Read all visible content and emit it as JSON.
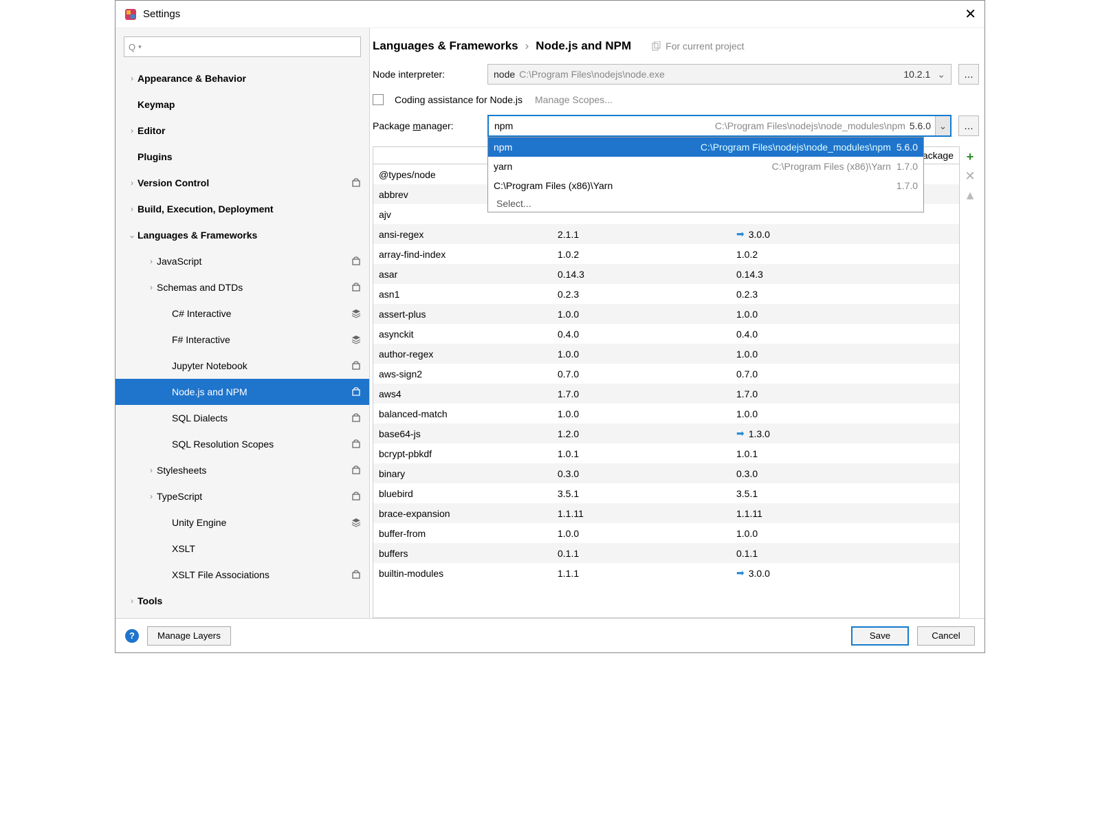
{
  "window": {
    "title": "Settings"
  },
  "breadcrumb": {
    "a": "Languages & Frameworks",
    "b": "Node.js and NPM"
  },
  "scope": "For current project",
  "labels": {
    "node_interpreter": "Node interpreter:",
    "coding_assist": "Coding assistance for Node.js",
    "manage_scopes": "Manage Scopes...",
    "package_manager_pre": "Package ",
    "package_manager_u": "m",
    "package_manager_post": "anager:",
    "col_package": "Package"
  },
  "interpreter": {
    "name": "node",
    "path": "C:\\Program Files\\nodejs\\node.exe",
    "version": "10.2.1"
  },
  "pkgmgr_input": {
    "name": "npm",
    "path": "C:\\Program Files\\nodejs\\node_modules\\npm",
    "version": "5.6.0"
  },
  "dropdown": [
    {
      "name": "npm",
      "path": "C:\\Program Files\\nodejs\\node_modules\\npm",
      "ver": "5.6.0",
      "sel": true
    },
    {
      "name": "yarn",
      "path": "C:\\Program Files (x86)\\Yarn",
      "ver": "1.7.0",
      "sel": false
    },
    {
      "name": "C:\\Program Files (x86)\\Yarn",
      "path": "",
      "ver": "1.7.0",
      "sel": false
    }
  ],
  "dd_select": "Select...",
  "tree": [
    {
      "lbl": "Appearance & Behavior",
      "lvl": 0,
      "bold": true,
      "exp": "›",
      "badge": ""
    },
    {
      "lbl": "Keymap",
      "lvl": 0,
      "bold": true,
      "exp": "",
      "badge": ""
    },
    {
      "lbl": "Editor",
      "lvl": 0,
      "bold": true,
      "exp": "›",
      "badge": ""
    },
    {
      "lbl": "Plugins",
      "lvl": 0,
      "bold": true,
      "exp": "",
      "badge": ""
    },
    {
      "lbl": "Version Control",
      "lvl": 0,
      "bold": true,
      "exp": "›",
      "badge": "bag"
    },
    {
      "lbl": "Build, Execution, Deployment",
      "lvl": 0,
      "bold": true,
      "exp": "›",
      "badge": ""
    },
    {
      "lbl": "Languages & Frameworks",
      "lvl": 0,
      "bold": true,
      "exp": "⌄",
      "badge": ""
    },
    {
      "lbl": "JavaScript",
      "lvl": 1,
      "bold": false,
      "exp": "›",
      "badge": "bag"
    },
    {
      "lbl": "Schemas and DTDs",
      "lvl": 1,
      "bold": false,
      "exp": "›",
      "badge": "bag"
    },
    {
      "lbl": "C# Interactive",
      "lvl": 2,
      "bold": false,
      "exp": "",
      "badge": "layers"
    },
    {
      "lbl": "F# Interactive",
      "lvl": 2,
      "bold": false,
      "exp": "",
      "badge": "layers"
    },
    {
      "lbl": "Jupyter Notebook",
      "lvl": 2,
      "bold": false,
      "exp": "",
      "badge": "bag"
    },
    {
      "lbl": "Node.js and NPM",
      "lvl": 2,
      "bold": false,
      "exp": "",
      "badge": "bag",
      "sel": true
    },
    {
      "lbl": "SQL Dialects",
      "lvl": 2,
      "bold": false,
      "exp": "",
      "badge": "bag"
    },
    {
      "lbl": "SQL Resolution Scopes",
      "lvl": 2,
      "bold": false,
      "exp": "",
      "badge": "bag"
    },
    {
      "lbl": "Stylesheets",
      "lvl": 1,
      "bold": false,
      "exp": "›",
      "badge": "bag"
    },
    {
      "lbl": "TypeScript",
      "lvl": 1,
      "bold": false,
      "exp": "›",
      "badge": "bag"
    },
    {
      "lbl": "Unity Engine",
      "lvl": 2,
      "bold": false,
      "exp": "",
      "badge": "layers"
    },
    {
      "lbl": "XSLT",
      "lvl": 2,
      "bold": false,
      "exp": "",
      "badge": ""
    },
    {
      "lbl": "XSLT File Associations",
      "lvl": 2,
      "bold": false,
      "exp": "",
      "badge": "bag"
    },
    {
      "lbl": "Tools",
      "lvl": 0,
      "bold": true,
      "exp": "›",
      "badge": ""
    }
  ],
  "packages": [
    {
      "name": "@types/node",
      "ver": "",
      "latest": "",
      "upg": false
    },
    {
      "name": "abbrev",
      "ver": "",
      "latest": "",
      "upg": false
    },
    {
      "name": "ajv",
      "ver": "",
      "latest": "",
      "upg": false
    },
    {
      "name": "ansi-regex",
      "ver": "2.1.1",
      "latest": "3.0.0",
      "upg": true
    },
    {
      "name": "array-find-index",
      "ver": "1.0.2",
      "latest": "1.0.2",
      "upg": false
    },
    {
      "name": "asar",
      "ver": "0.14.3",
      "latest": "0.14.3",
      "upg": false
    },
    {
      "name": "asn1",
      "ver": "0.2.3",
      "latest": "0.2.3",
      "upg": false
    },
    {
      "name": "assert-plus",
      "ver": "1.0.0",
      "latest": "1.0.0",
      "upg": false
    },
    {
      "name": "asynckit",
      "ver": "0.4.0",
      "latest": "0.4.0",
      "upg": false
    },
    {
      "name": "author-regex",
      "ver": "1.0.0",
      "latest": "1.0.0",
      "upg": false
    },
    {
      "name": "aws-sign2",
      "ver": "0.7.0",
      "latest": "0.7.0",
      "upg": false
    },
    {
      "name": "aws4",
      "ver": "1.7.0",
      "latest": "1.7.0",
      "upg": false
    },
    {
      "name": "balanced-match",
      "ver": "1.0.0",
      "latest": "1.0.0",
      "upg": false
    },
    {
      "name": "base64-js",
      "ver": "1.2.0",
      "latest": "1.3.0",
      "upg": true
    },
    {
      "name": "bcrypt-pbkdf",
      "ver": "1.0.1",
      "latest": "1.0.1",
      "upg": false
    },
    {
      "name": "binary",
      "ver": "0.3.0",
      "latest": "0.3.0",
      "upg": false
    },
    {
      "name": "bluebird",
      "ver": "3.5.1",
      "latest": "3.5.1",
      "upg": false
    },
    {
      "name": "brace-expansion",
      "ver": "1.1.11",
      "latest": "1.1.11",
      "upg": false
    },
    {
      "name": "buffer-from",
      "ver": "1.0.0",
      "latest": "1.0.0",
      "upg": false
    },
    {
      "name": "buffers",
      "ver": "0.1.1",
      "latest": "0.1.1",
      "upg": false
    },
    {
      "name": "builtin-modules",
      "ver": "1.1.1",
      "latest": "3.0.0",
      "upg": true
    }
  ],
  "footer": {
    "manage": "Manage Layers",
    "save": "Save",
    "cancel": "Cancel"
  }
}
